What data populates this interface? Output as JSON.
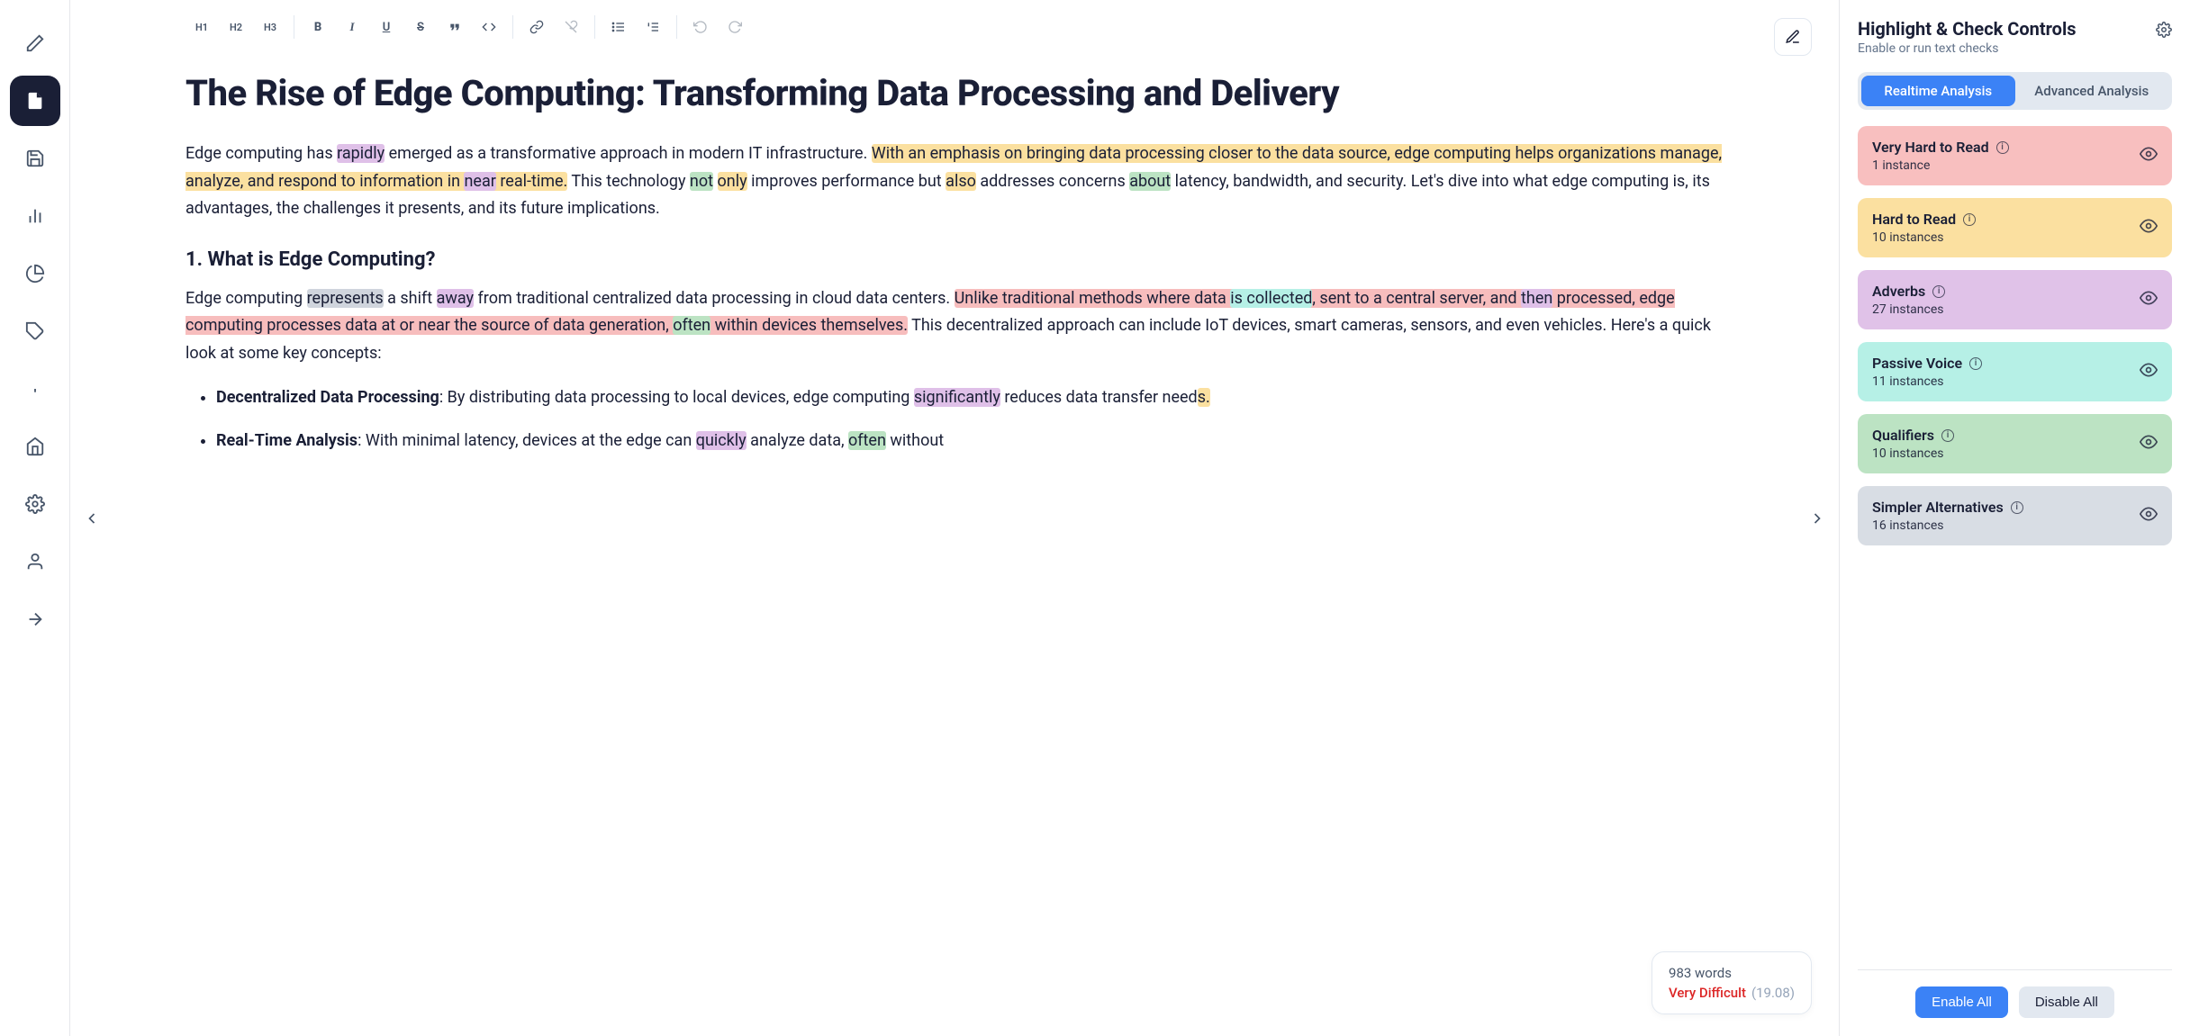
{
  "toolbar": {
    "h1": "H1",
    "h2": "H2",
    "h3": "H3",
    "bold": "B",
    "italic": "I",
    "underline": "U",
    "strike": "S"
  },
  "document": {
    "title": "The Rise of Edge Computing: Transforming Data Processing and Delivery",
    "p1": {
      "t1": "Edge computing has ",
      "hl1": "rapidly",
      "t2": " emerged as a transformative approach in modern IT infrastructure. ",
      "hl2": "With an emphasis on bringing data processing closer to the data source, edge computing helps organizations manage, analyze, and respond to information in ",
      "hl3": "near",
      "hl4": " real-time.",
      "t3": " This technology ",
      "hl5": "not",
      "t4": " ",
      "hl6": "only",
      "t5": " improves performance but ",
      "hl7": "also",
      "t6": " addresses concerns ",
      "hl8": "about",
      "t7": " latency, bandwidth, and security. Let's dive into what edge computing is, its advantages, the challenges it presents, and its future implications."
    },
    "h2_1": "1. What is Edge Computing?",
    "p2": {
      "t1": "Edge computing ",
      "hl1": "represents",
      "t2": " a shift ",
      "hl2": "away",
      "t3": " from traditional centralized data processing in cloud data centers. ",
      "hl3": "Unlike traditional methods where data ",
      "hl4": "is collected",
      "hl5": ", sent to a central server, and ",
      "hl6": "then",
      "hl7": " processed, edge computing processes data at or near the source of data generation, ",
      "hl8": "often",
      "hl9": " within devices themselves.",
      "t4": " This decentralized approach can include IoT devices, smart cameras, sensors, and even vehicles. Here's a quick look at some key concepts:"
    },
    "li1": {
      "bold": "Decentralized Data Processing",
      "t1": ": By distributing data processing to local devices, edge computing ",
      "hl1": "significantly",
      "t2": " reduces data transfer need",
      "hl2": "s."
    },
    "li2": {
      "bold": "Real-Time Analysis",
      "t1": ": With minimal latency, devices at the edge can ",
      "hl1": "quickly",
      "t2": " analyze data, ",
      "hl2": "often",
      "t3": " without"
    }
  },
  "stats": {
    "words": "983 words",
    "difficulty_label": "Very Difficult",
    "difficulty_score": "(19.08)"
  },
  "panel": {
    "title": "Highlight & Check Controls",
    "subtitle": "Enable or run text checks",
    "tabs": {
      "realtime": "Realtime Analysis",
      "advanced": "Advanced Analysis"
    },
    "checks": [
      {
        "title": "Very Hard to Read",
        "count": "1 instance",
        "bg": "#f8bfbf"
      },
      {
        "title": "Hard to Read",
        "count": "10 instances",
        "bg": "#fbe0a0"
      },
      {
        "title": "Adverbs",
        "count": "27 instances",
        "bg": "#e0c2e8"
      },
      {
        "title": "Passive Voice",
        "count": "11 instances",
        "bg": "#b6f0e6"
      },
      {
        "title": "Qualifiers",
        "count": "10 instances",
        "bg": "#bce3c3"
      },
      {
        "title": "Simpler Alternatives",
        "count": "16 instances",
        "bg": "#d8dde4"
      }
    ],
    "enable_all": "Enable All",
    "disable_all": "Disable All"
  }
}
